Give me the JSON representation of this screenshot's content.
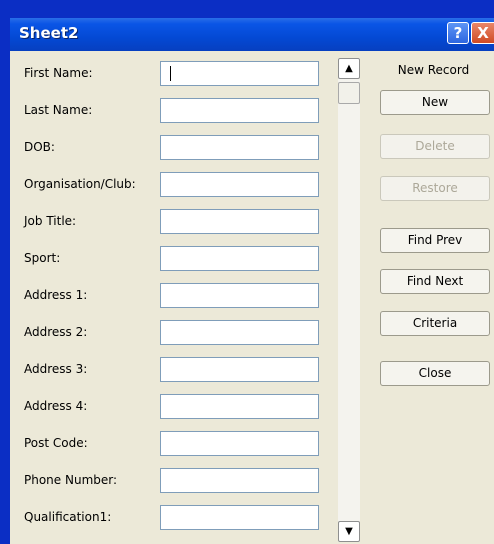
{
  "window": {
    "title": "Sheet2",
    "help_glyph": "?",
    "close_glyph": "X"
  },
  "fields": [
    {
      "label": "First Name:",
      "value": ""
    },
    {
      "label": "Last Name:",
      "value": ""
    },
    {
      "label": "DOB:",
      "value": ""
    },
    {
      "label": "Organisation/Club:",
      "value": ""
    },
    {
      "label": "Job Title:",
      "value": ""
    },
    {
      "label": "Sport:",
      "value": ""
    },
    {
      "label": "Address 1:",
      "value": ""
    },
    {
      "label": "Address 2:",
      "value": ""
    },
    {
      "label": "Address 3:",
      "value": ""
    },
    {
      "label": "Address 4:",
      "value": ""
    },
    {
      "label": "Post Code:",
      "value": ""
    },
    {
      "label": "Phone Number:",
      "value": ""
    },
    {
      "label": "Qualification1:",
      "value": ""
    }
  ],
  "scrollbar": {
    "up_glyph": "▲",
    "down_glyph": "▼"
  },
  "record_status": "New Record",
  "buttons": {
    "new": "New",
    "delete": "Delete",
    "restore": "Restore",
    "find_prev": "Find Prev",
    "find_next": "Find Next",
    "criteria": "Criteria",
    "close": "Close"
  },
  "colors": {
    "desktop": "#0b2ec4",
    "titlebar": "#0449d4",
    "dialog_face": "#ece9d8",
    "disabled_text": "#aca899"
  }
}
